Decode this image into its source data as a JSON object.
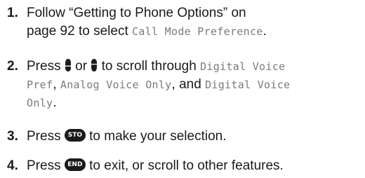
{
  "steps": [
    {
      "num": "1.",
      "line1": "Follow “Getting to Phone Options” on",
      "line2_pre": "page 92 to select ",
      "line2_lcd": "Call Mode Preference",
      "line2_post": "."
    },
    {
      "num": "2.",
      "pre": "Press",
      "or": "or",
      "mid": "to scroll through",
      "lcd1": "Digital Voice",
      "lcd1b": "Pref",
      "comma1": ",",
      "lcd2": "Analog Voice Only",
      "and_text": ", and",
      "lcd3": "Digital Voice",
      "lcd3b": "Only",
      "period": "."
    },
    {
      "num": "3.",
      "pre": "Press",
      "key": "STO",
      "post": "to make your selection."
    },
    {
      "num": "4.",
      "pre": "Press",
      "key": "END",
      "post": "to exit, or scroll to other features."
    }
  ],
  "icons": {
    "scroll_down": "scroll-down-key-icon",
    "scroll_up": "scroll-up-key-icon",
    "sto": "sto-key-icon",
    "end": "end-key-icon"
  }
}
